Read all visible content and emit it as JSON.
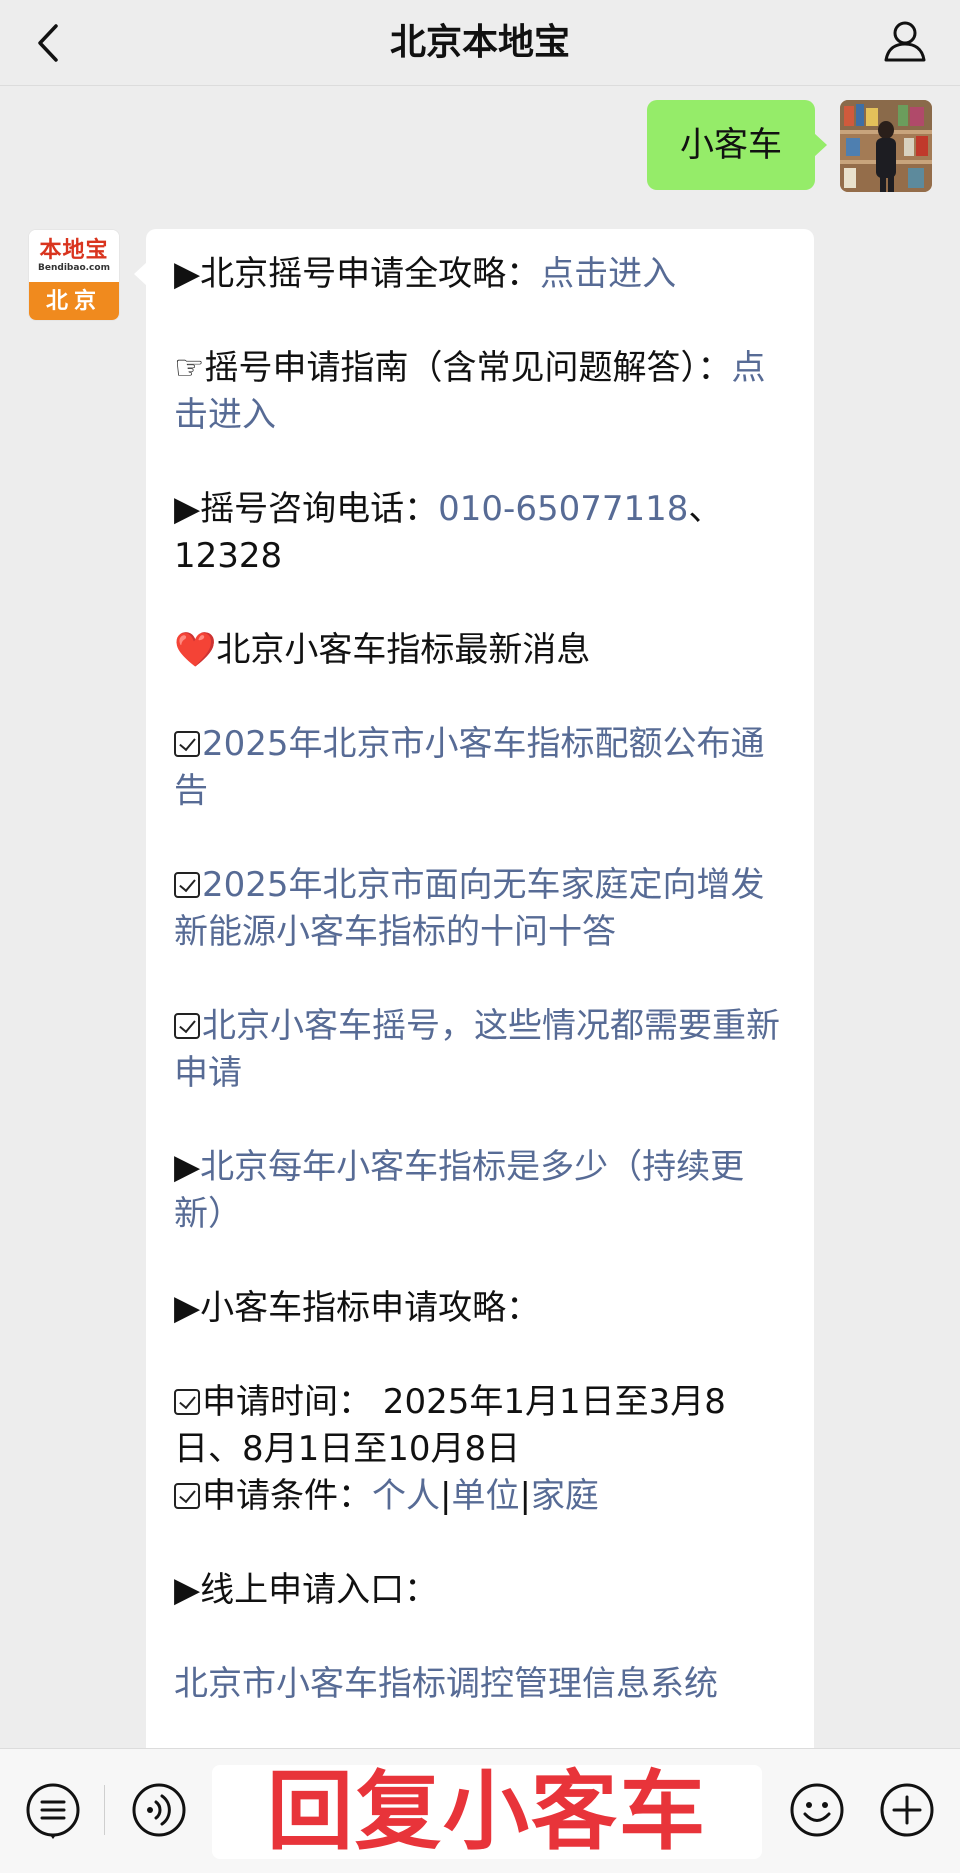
{
  "header": {
    "title": "北京本地宝",
    "back_icon": "chevron-left-icon",
    "profile_icon": "person-icon"
  },
  "outgoing": {
    "text": "小客车"
  },
  "bot": {
    "avatar_logo": "本地宝",
    "avatar_sub": "Bendibao.com",
    "avatar_city": "北京"
  },
  "message": {
    "p1_prefix": "▶北京摇号申请全攻略：",
    "p1_link": "点击进入",
    "p2_prefix": "☞摇号申请指南（含常见问题解答）：",
    "p2_link": "点击进入",
    "p3_prefix": "▶摇号咨询电话：",
    "p3_phone1": "010-65077118",
    "p3_sep": "、",
    "p3_phone2": "12328",
    "p4_heart": "❤️",
    "p4_text": "北京小客车指标最新消息",
    "p5_link": "2025年北京市小客车指标配额公布通告",
    "p6_link": "2025年北京市面向无车家庭定向增发新能源小客车指标的十问十答",
    "p7_link": "北京小客车摇号，这些情况都需要重新申请",
    "p8_prefix": "▶",
    "p8_link": "北京每年小客车指标是多少（持续更新）",
    "p9_text": "▶小客车指标申请攻略：",
    "p10_text": "申请时间： 2025年1月1日至3月8日、8月1日至10月8日",
    "p11_prefix": "申请条件：",
    "p11_link1": "个人",
    "p11_sep1": "|",
    "p11_link2": "单位",
    "p11_sep2": "|",
    "p11_link3": "家庭",
    "p12_text": "▶线上申请入口：",
    "p13_link": "北京市小客车指标调控管理信息系统"
  },
  "bottombar": {
    "menu_icon": "menu-list-icon",
    "voice_icon": "voice-icon",
    "overlay_text": "回复小客车",
    "emoji_icon": "emoji-icon",
    "plus_icon": "plus-icon"
  },
  "colors": {
    "link": "#576b95",
    "bubble_out": "#95ec69",
    "overlay": "#e8343a"
  }
}
